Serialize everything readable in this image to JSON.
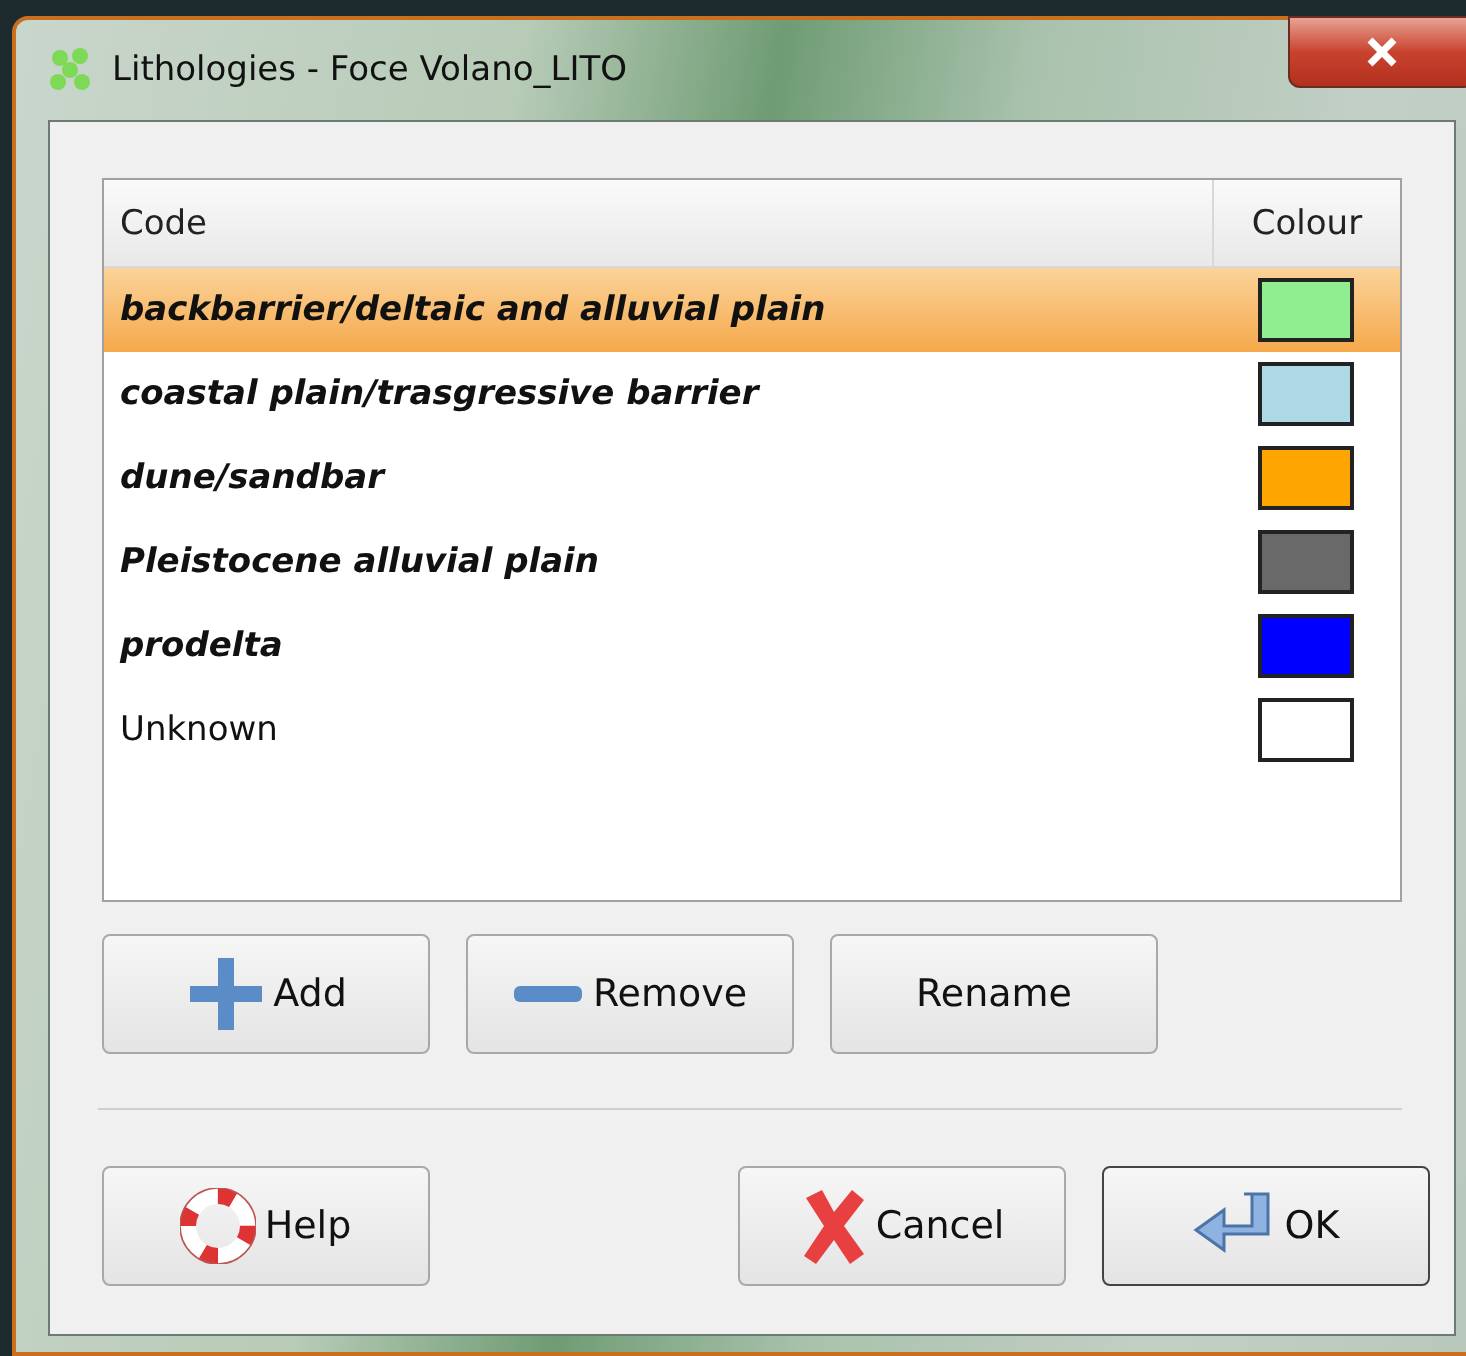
{
  "window": {
    "title": "Lithologies - Foce Volano_LITO"
  },
  "table": {
    "columns": [
      "Code",
      "Colour"
    ],
    "rows": [
      {
        "code": "backbarrier/deltaic and alluvial plain",
        "color": "#90ee90",
        "emphasized": true,
        "selected": true
      },
      {
        "code": "coastal plain/trasgressive barrier",
        "color": "#add8e6",
        "emphasized": true,
        "selected": false
      },
      {
        "code": "dune/sandbar",
        "color": "#ffa500",
        "emphasized": true,
        "selected": false
      },
      {
        "code": "Pleistocene alluvial plain",
        "color": "#696969",
        "emphasized": true,
        "selected": false
      },
      {
        "code": "prodelta",
        "color": "#0000ff",
        "emphasized": true,
        "selected": false
      },
      {
        "code": "Unknown",
        "color": "#ffffff",
        "emphasized": false,
        "selected": false
      }
    ]
  },
  "edit_buttons": [
    {
      "label": "Add",
      "kind": "add"
    },
    {
      "label": "Remove",
      "kind": "remove"
    },
    {
      "label": "Rename",
      "kind": "rename"
    }
  ],
  "dialog_buttons": [
    {
      "label": "Help",
      "kind": "help",
      "default": false
    },
    {
      "label": "Cancel",
      "kind": "cancel",
      "default": false
    },
    {
      "label": "OK",
      "kind": "ok",
      "default": true
    }
  ]
}
